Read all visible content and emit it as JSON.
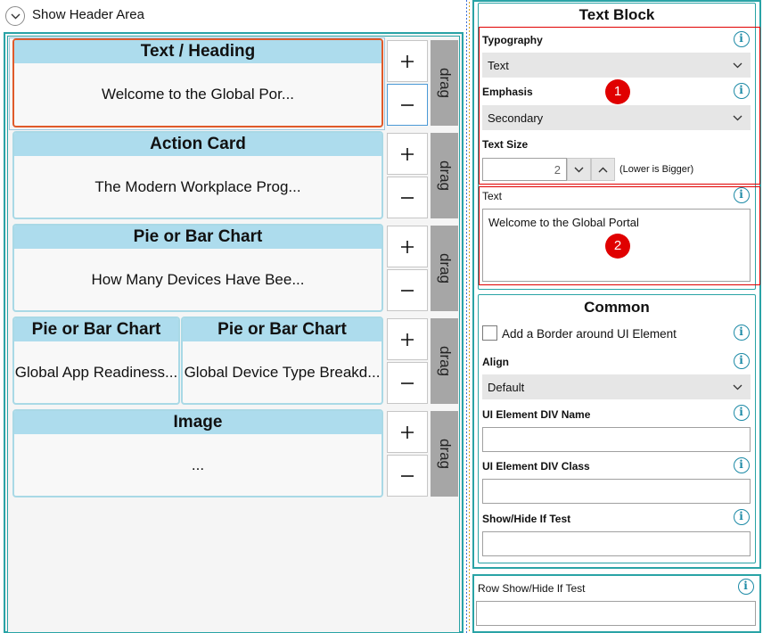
{
  "header_toggle": {
    "label": "Show Header Area"
  },
  "rows": [
    {
      "cards": [
        {
          "title": "Text / Heading",
          "body": "Welcome to the Global Por..."
        }
      ]
    },
    {
      "cards": [
        {
          "title": "Action Card",
          "body": "The Modern Workplace Prog..."
        }
      ]
    },
    {
      "cards": [
        {
          "title": "Pie or Bar Chart",
          "body": "How Many Devices Have Bee..."
        }
      ]
    },
    {
      "cards": [
        {
          "title": "Pie or Bar Chart",
          "body": "Global App Readiness..."
        },
        {
          "title": "Pie or Bar Chart",
          "body": "Global Device Type Breakd..."
        }
      ]
    },
    {
      "cards": [
        {
          "title": "Image",
          "body": "..."
        }
      ]
    }
  ],
  "row_controls": {
    "add": "+",
    "remove": "−",
    "drag": "drag"
  },
  "text_block": {
    "title": "Text Block",
    "typography": {
      "label": "Typography",
      "value": "Text"
    },
    "emphasis": {
      "label": "Emphasis",
      "value": "Secondary"
    },
    "text_size": {
      "label": "Text Size",
      "value": "2",
      "hint": "(Lower is Bigger)"
    },
    "text": {
      "label": "Text",
      "value": "Welcome to the Global Portal"
    },
    "badges": [
      "1",
      "2"
    ]
  },
  "common": {
    "title": "Common",
    "border_checkbox": {
      "label": "Add a Border around UI Element",
      "checked": false
    },
    "align": {
      "label": "Align",
      "value": "Default"
    },
    "div_name": {
      "label": "UI Element DIV Name",
      "value": ""
    },
    "div_class": {
      "label": "UI Element DIV Class",
      "value": ""
    },
    "show_hide": {
      "label": "Show/Hide If Test",
      "value": ""
    }
  },
  "row_show_hide": {
    "label": "Row Show/Hide If Test",
    "value": ""
  },
  "colors": {
    "accent": "#29a3a6",
    "card_header": "#addced",
    "card_border": "#a9d9e6",
    "selected_border": "#e05a2a",
    "drag_handle": "#a6a6a6",
    "callout_red": "#e00000",
    "info_icon": "#1c8aa6"
  },
  "icons": {
    "toggle": "chevron-down-icon",
    "info": "info-icon",
    "dropdown": "chevron-down-icon",
    "stepper_down": "chevron-down-icon",
    "stepper_up": "chevron-up-icon"
  }
}
